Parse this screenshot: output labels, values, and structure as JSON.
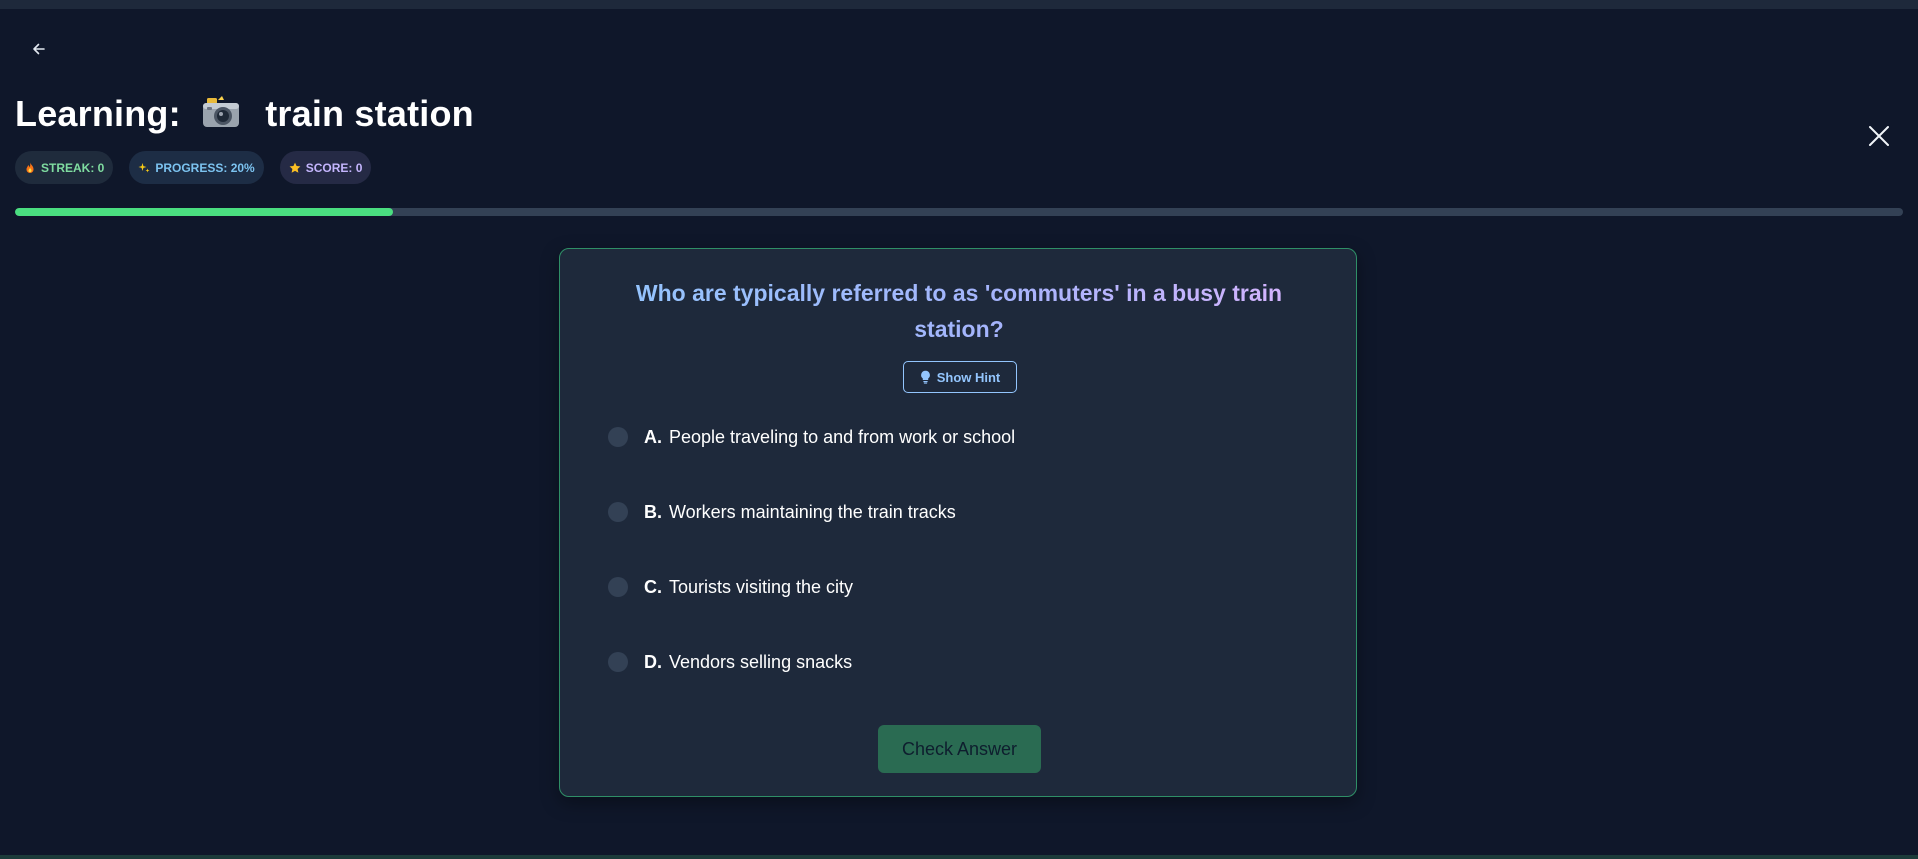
{
  "header": {
    "back_icon": "arrow-left-icon",
    "close_icon": "close-icon",
    "title_prefix": "Learning:",
    "title_emoji": "camera-icon",
    "title_topic": "train station"
  },
  "badges": {
    "streak": {
      "icon": "fire-icon",
      "label": "STREAK: 0"
    },
    "progress": {
      "icon": "sparkles-icon",
      "label": "PROGRESS: 20%"
    },
    "score": {
      "icon": "star-icon",
      "label": "SCORE: 0"
    }
  },
  "progress": {
    "value": 0.2
  },
  "quiz": {
    "question": "Who are typically referred to as 'commuters' in a busy train station?",
    "hint_label": "Show Hint",
    "hint_icon": "lightbulb-icon",
    "options": [
      {
        "letter": "A.",
        "text": "People traveling to and from work or school"
      },
      {
        "letter": "B.",
        "text": "Workers maintaining the train tracks"
      },
      {
        "letter": "C.",
        "text": "Tourists visiting the city"
      },
      {
        "letter": "D.",
        "text": "Vendors selling snacks"
      }
    ],
    "submit_label": "Check Answer"
  },
  "colors": {
    "background": "#0f172a",
    "card": "#1e293b",
    "card_border": "#2f8f67",
    "progress_fill": "#4ade80",
    "progress_track": "#334155",
    "hint_blue": "#93c5fd",
    "check_button": "#2a6b52"
  }
}
